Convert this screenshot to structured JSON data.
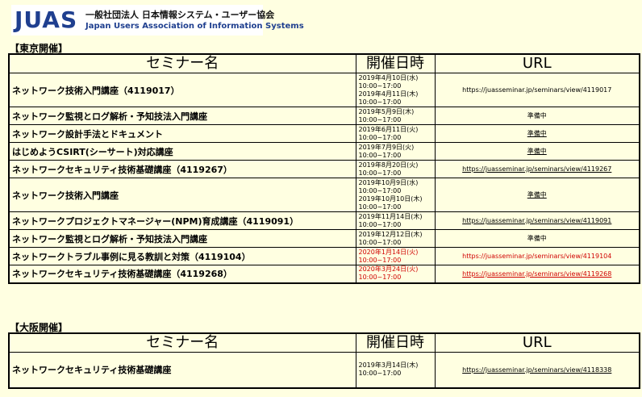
{
  "logo": {
    "brand": "JUAS",
    "org_jp": "一般社団法人 日本情報システム・ユーザー協会",
    "org_en": "Japan Users Association of Information Systems"
  },
  "tokyo": {
    "label": "【東京開催】",
    "headers": [
      "セミナー名",
      "開催日時",
      "URL"
    ],
    "rows": [
      {
        "name": "ネットワーク技術入門講座（4119017）",
        "dates": [
          "2019年4月10日(水)",
          "10:00~17:00",
          "2019年4月11日(木)",
          "10:00~17:00"
        ],
        "url": "https://juasseminar.jp/seminars/view/4119017",
        "red": false,
        "link": false
      },
      {
        "name": "ネットワーク監視とログ解析・予知技法入門講座",
        "dates": [
          "2019年5月9日(木)",
          "10:00~17:00"
        ],
        "url": "準備中",
        "red": false,
        "link": false
      },
      {
        "name": "ネットワーク設計手法とドキュメント",
        "dates": [
          "2019年6月11日(火)",
          "10:00~17:00"
        ],
        "url": "準備中",
        "red": false,
        "link": true
      },
      {
        "name": "はじめようCSIRT(シーサート)対応講座",
        "dates": [
          "2019年7月9日(火)",
          "10:00~17:00"
        ],
        "url": "準備中",
        "red": false,
        "link": true
      },
      {
        "name": "ネットワークセキュリティ技術基礎講座（4119267）",
        "dates": [
          "2019年8月20日(火)",
          "10:00~17:00"
        ],
        "url": "https://juasseminar.jp/seminars/view/4119267",
        "red": false,
        "link": true
      },
      {
        "name": "ネットワーク技術入門講座",
        "dates": [
          "2019年10月9日(水)",
          "10:00~17:00",
          "2019年10月10日(木)",
          "10:00~17:00"
        ],
        "url": "準備中",
        "red": false,
        "link": true
      },
      {
        "name": "ネットワークプロジェクトマネージャー(NPM)育成講座（4119091）",
        "dates": [
          "2019年11月14日(木)",
          "10:00~17:00"
        ],
        "url": "https://juasseminar.jp/seminars/view/4119091",
        "red": false,
        "link": true
      },
      {
        "name": "ネットワーク監視とログ解析・予知技法入門講座",
        "dates": [
          "2019年12月12日(木)",
          "10:00~17:00"
        ],
        "url": "準備中",
        "red": false,
        "link": false
      },
      {
        "name": "ネットワークトラブル事例に見る教訓と対策（4119104）",
        "dates": [
          "2020年1月14日(火)",
          "10:00~17:00"
        ],
        "url": "https://juasseminar.jp/seminars/view/4119104",
        "red": true,
        "link": false
      },
      {
        "name": "ネットワークセキュリティ技術基礎講座（4119268）",
        "dates": [
          "2020年3月24日(火)",
          "10:00~17:00"
        ],
        "url": "https://juasseminar.jp/seminars/view/4119268",
        "red": true,
        "link": true
      }
    ]
  },
  "osaka": {
    "label": "【大阪開催】",
    "headers": [
      "セミナー名",
      "開催日時",
      "URL"
    ],
    "rows": [
      {
        "name": "ネットワークセキュリティ技術基礎講座",
        "dates": [
          "2019年3月14日(木)",
          "10:00~17:00"
        ],
        "url": "https://juasseminar.jp/seminars/view/4118338",
        "red": false,
        "link": true
      }
    ]
  },
  "colors": {
    "background": "#ffffe1",
    "red": "#d00000",
    "brand": "#1f3f8f"
  }
}
